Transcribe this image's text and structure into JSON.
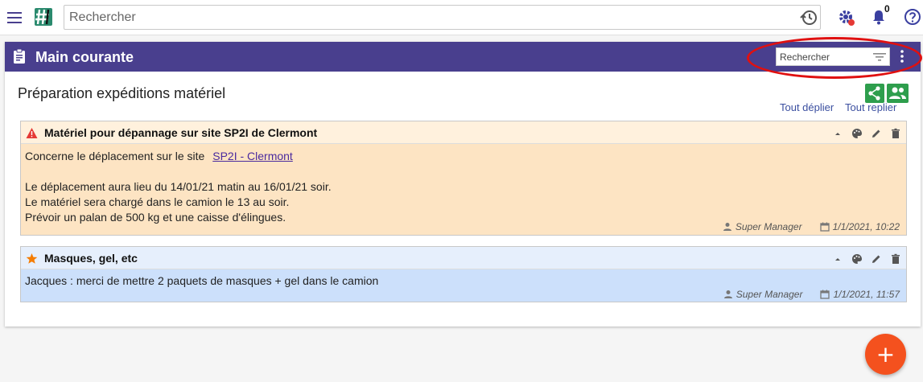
{
  "topbar": {
    "search_placeholder": "Rechercher",
    "notification_count": "0"
  },
  "card": {
    "title": "Main courante",
    "search_placeholder": "Rechercher",
    "accent_color": "#493f8e"
  },
  "section": {
    "title": "Préparation expéditions matériel",
    "expand_all": "Tout déplier",
    "collapse_all": "Tout replier"
  },
  "entries": [
    {
      "title": "Matériel pour dépannage sur site SP2I de Clermont",
      "icon": "warning-icon",
      "color": "#fde4c3",
      "line_1_prefix": "Concerne le déplacement sur le site",
      "link_text": "SP2I - Clermont",
      "line_2": "Le déplacement aura lieu du 14/01/21 matin au 16/01/21 soir.",
      "line_3": "Le matériel sera chargé dans le camion le 13 au soir.",
      "line_4": "Prévoir un palan de 500 kg et une caisse d'élingues.",
      "author": "Super Manager",
      "date": "1/1/2021, 10:22"
    },
    {
      "title": "Masques, gel, etc",
      "icon": "star-icon",
      "color": "#cce0fb",
      "text": "Jacques : merci de mettre 2 paquets de masques + gel dans le camion",
      "author": "Super Manager",
      "date": "1/1/2021, 11:57"
    }
  ],
  "fab": {
    "label": "+"
  }
}
